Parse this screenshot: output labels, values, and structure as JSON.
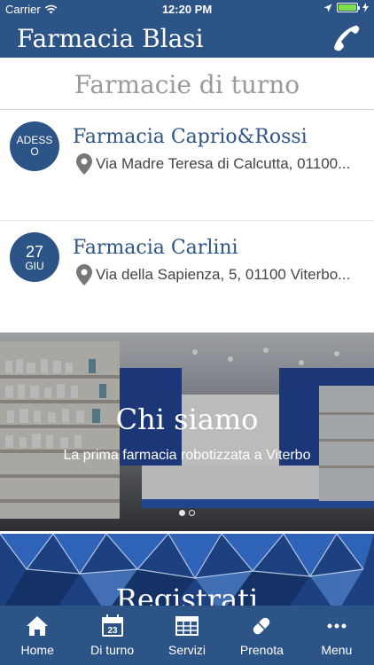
{
  "status_bar": {
    "carrier": "Carrier",
    "time": "12:20 PM"
  },
  "header": {
    "title": "Farmacia Blasi",
    "phone_icon": "phone-icon"
  },
  "section": {
    "title": "Farmacie di turno"
  },
  "pharmacies": [
    {
      "badge_top": "ADESS",
      "badge_bottom": "O",
      "name": "Farmacia Caprio&Rossi",
      "address": "Via Madre Teresa di Calcutta, 01100..."
    },
    {
      "badge_top": "27",
      "badge_bottom": "GIU",
      "name": "Farmacia Carlini",
      "address": "Via della Sapienza, 5, 01100 Viterbo..."
    }
  ],
  "banner": {
    "title": "Chi siamo",
    "subtitle": "La prima farmacia robotizzata a Viterbo"
  },
  "banner2": {
    "title": "Registrati"
  },
  "tabs": [
    {
      "label": "Home",
      "icon": "home-icon"
    },
    {
      "label": "Di turno",
      "icon": "calendar-icon",
      "icon_text": "23"
    },
    {
      "label": "Servizi",
      "icon": "services-icon"
    },
    {
      "label": "Prenota",
      "icon": "pill-icon"
    },
    {
      "label": "Menu",
      "icon": "more-icon"
    }
  ],
  "colors": {
    "primary": "#2d5486",
    "heading_gray": "#9a9a9a",
    "battery_green": "#7ee04a"
  }
}
